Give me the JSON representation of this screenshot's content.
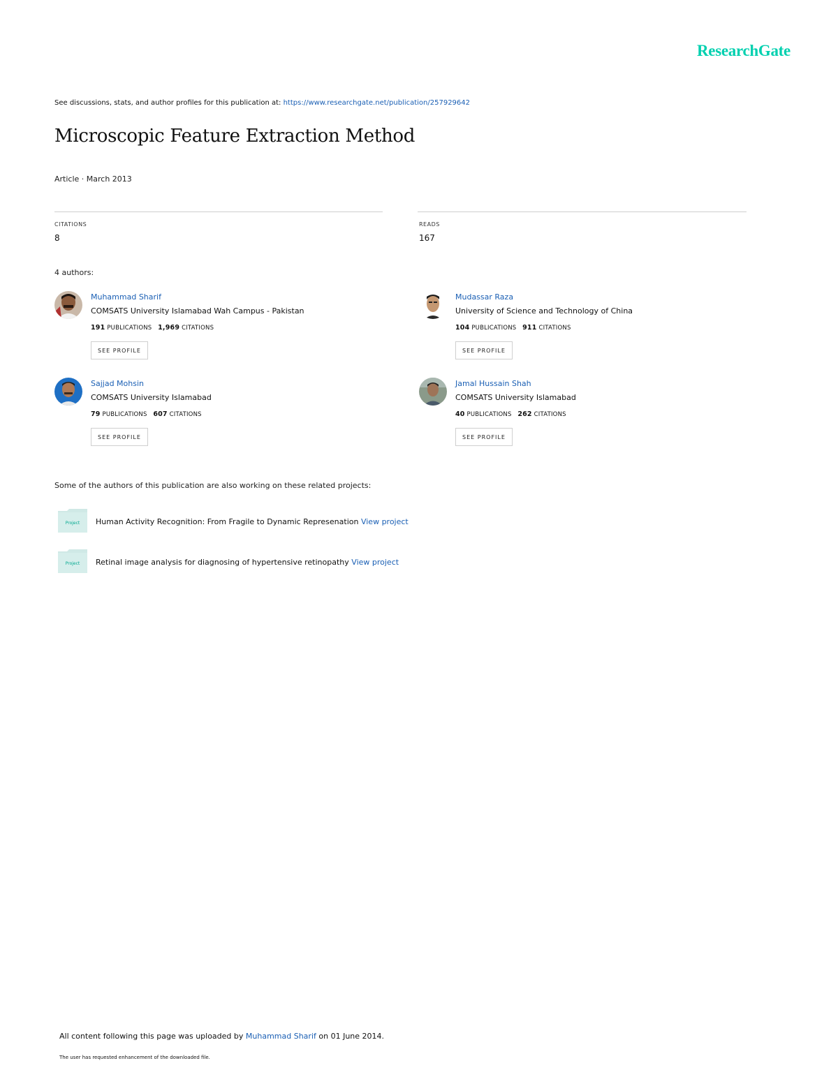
{
  "header": {
    "logo": "ResearchGate",
    "discussion_prefix": "See discussions, stats, and author profiles for this publication at:",
    "discussion_url": "https://www.researchgate.net/publication/257929642"
  },
  "publication": {
    "title": "Microscopic Feature Extraction Method",
    "meta": "Article · March 2013"
  },
  "stats": {
    "citations_label": "CITATIONS",
    "citations_value": "8",
    "reads_label": "READS",
    "reads_value": "167"
  },
  "authors_heading": "4 authors:",
  "authors": [
    {
      "name": "Muhammad Sharif",
      "institution": "COMSATS University Islamabad Wah Campus - Pakistan",
      "publications": "191",
      "publications_label": "PUBLICATIONS",
      "citations": "1,969",
      "citations_label": "CITATIONS",
      "button": "SEE PROFILE"
    },
    {
      "name": "Mudassar Raza",
      "institution": "University of Science and Technology of China",
      "publications": "104",
      "publications_label": "PUBLICATIONS",
      "citations": "911",
      "citations_label": "CITATIONS",
      "button": "SEE PROFILE"
    },
    {
      "name": "Sajjad Mohsin",
      "institution": "COMSATS University Islamabad",
      "publications": "79",
      "publications_label": "PUBLICATIONS",
      "citations": "607",
      "citations_label": "CITATIONS",
      "button": "SEE PROFILE"
    },
    {
      "name": "Jamal Hussain Shah",
      "institution": "COMSATS University Islamabad",
      "publications": "40",
      "publications_label": "PUBLICATIONS",
      "citations": "262",
      "citations_label": "CITATIONS",
      "button": "SEE PROFILE"
    }
  ],
  "related": {
    "heading": "Some of the authors of this publication are also working on these related projects:",
    "folder_label": "Project",
    "projects": [
      {
        "title": "Human Activity Recognition: From Fragile to Dynamic Represenation",
        "link": "View project"
      },
      {
        "title": "Retinal image analysis for diagnosing of hypertensive retinopathy",
        "link": "View project"
      }
    ]
  },
  "footer": {
    "uploaded_prefix": "All content following this page was uploaded by",
    "uploaded_by": "Muhammad Sharif",
    "uploaded_suffix": "on 01 June 2014.",
    "note": "The user has requested enhancement of the downloaded file."
  },
  "colors": {
    "brand": "#00d0af",
    "link": "#1a5fb4",
    "folder": "#cfe9e6"
  }
}
